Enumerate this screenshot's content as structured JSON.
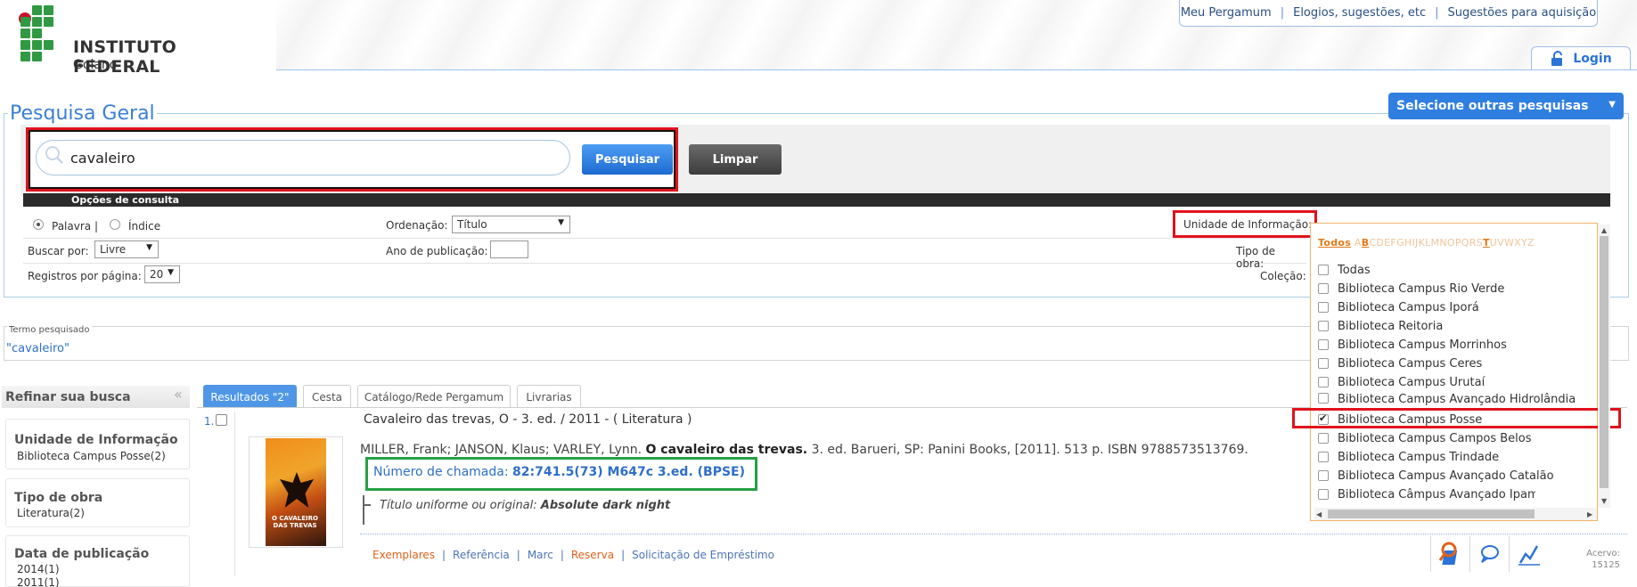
{
  "header": {
    "logo_name": "INSTITUTO FEDERAL",
    "logo_sub": "Goiano",
    "top_links": [
      "Meu Pergamum",
      "Elogios, sugestões, etc",
      "Sugestões para aquisição"
    ],
    "login_label": "Login"
  },
  "search": {
    "legend": "Pesquisa Geral",
    "other_searches": "Selecione outras pesquisas",
    "query": "cavaleiro",
    "search_button": "Pesquisar",
    "clear_button": "Limpar"
  },
  "options": {
    "bar_title": "Opções de consulta",
    "radio_word": "Palavra |",
    "radio_index": "Índice",
    "search_by_label": "Buscar por:",
    "search_by_value": "Livre",
    "per_page_label": "Registros por página:",
    "per_page_value": "20",
    "order_label": "Ordenação:",
    "order_value": "Título",
    "pub_year_label": "Ano de publicação:",
    "unit_label": "Unidade de Informação:",
    "work_type_label": "Tipo de obra:",
    "collection_label": "Coleção:"
  },
  "unit_list": {
    "alpha_all": "Todos",
    "alpha_letters": [
      "A",
      "B",
      "C",
      "D",
      "E",
      "F",
      "G",
      "H",
      "I",
      "J",
      "K",
      "L",
      "M",
      "N",
      "O",
      "P",
      "Q",
      "R",
      "S",
      "T",
      "U",
      "V",
      "W",
      "X",
      "Y",
      "Z"
    ],
    "alpha_active": [
      "B",
      "T"
    ],
    "items": [
      {
        "label": "Todas",
        "checked": false
      },
      {
        "label": "Biblioteca Campus Rio Verde",
        "checked": false
      },
      {
        "label": "Biblioteca Campus Iporá",
        "checked": false
      },
      {
        "label": "Biblioteca Reitoria",
        "checked": false
      },
      {
        "label": "Biblioteca Campus Morrinhos",
        "checked": false
      },
      {
        "label": "Biblioteca Campus Ceres",
        "checked": false
      },
      {
        "label": "Biblioteca Campus Urutaí",
        "checked": false
      },
      {
        "label": "Biblioteca Campus Avançado Hidrolândia",
        "checked": false
      },
      {
        "label": "Biblioteca Campus Posse",
        "checked": true
      },
      {
        "label": "Biblioteca Campus Campos Belos",
        "checked": false
      },
      {
        "label": "Biblioteca Campus Trindade",
        "checked": false
      },
      {
        "label": "Biblioteca Campus Avançado Catalão",
        "checked": false
      },
      {
        "label": "Biblioteca Câmpus Avançado Ipameri",
        "checked": false
      }
    ]
  },
  "term": {
    "legend": "Termo pesquisado",
    "value": "\"cavaleiro\""
  },
  "refine": {
    "title": "Refinar sua busca",
    "groups": [
      {
        "title": "Unidade de Informação",
        "items": [
          "Biblioteca Campus Posse(2)"
        ]
      },
      {
        "title": "Tipo de obra",
        "items": [
          "Literatura(2)"
        ]
      },
      {
        "title": "Data de publicação",
        "items": [
          "2014(1)",
          "2011(1)"
        ]
      }
    ]
  },
  "tabs": [
    "Resultados \"2\"",
    "Cesta",
    "Catálogo/Rede Pergamum",
    "Livrarias"
  ],
  "result": {
    "number": "1.",
    "title": "Cavaleiro das trevas, O - 3. ed. / 2011 - ( Literatura )",
    "ref_authors": "MILLER, Frank; JANSON, Klaus; VARLEY, Lynn.",
    "ref_title": "O cavaleiro das trevas.",
    "ref_rest": "3. ed. Barueri, SP: Panini Books, [2011]. 513 p. ISBN 9788573513769.",
    "call_label": "Número de chamada:",
    "call_value": "82:741.5(73) M647c 3.ed. (BPSE)",
    "uniform_label": "Título uniforme ou original:",
    "uniform_value": "Absolute dark night",
    "cover_text": "O CAVALEIRO DAS TREVAS",
    "links": [
      "Exemplares",
      "Referência",
      "Marc",
      "Reserva",
      "Solicitação de Empréstimo"
    ],
    "acervo_label": "Acervo:",
    "acervo_value": "15125"
  },
  "colors": {
    "accent_blue": "#2f7fe0",
    "highlight_red": "#e0121d",
    "highlight_green": "#27a046",
    "link_orange": "#e2621b"
  }
}
